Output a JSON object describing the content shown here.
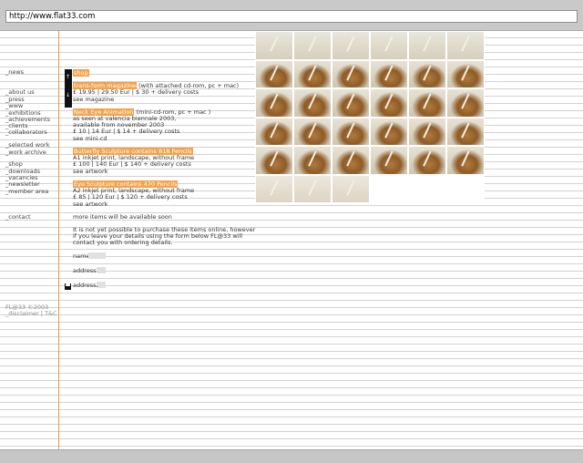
{
  "browser": {
    "url": "http://www.flat33.com"
  },
  "nav": {
    "news": "_news",
    "about_us": "_about us",
    "press": "_press",
    "www": "_www",
    "exhibitions": "_exhibitions",
    "achievements": "_achievements",
    "clients": "_clients",
    "collaborators": "_collaborators",
    "selected_work": "_selected work",
    "work_archive": "_work archive",
    "shop": "_shop",
    "downloads": "_downloads",
    "vacancies": "_vacancies",
    "newsletter": "_newsletter",
    "member_area": "_member area",
    "contact": "_contact",
    "copyright": "FL@33 ©2003",
    "disclaimer": "_disclaimer | T&C"
  },
  "sidebar": {
    "up_arrow": "↑",
    "down_arrow": "↓"
  },
  "shop": {
    "heading": "shop",
    "items": [
      {
        "title": "trans-form magazine",
        "desc": " (with attached cd-rom, pc + mac)",
        "price": "£ 19.95 | 29.50 Eur | $ 30 + delivery costs",
        "link": "see magazine"
      },
      {
        "title": "Neck Eye Animation",
        "desc": " (mini-cd-rom, pc + mac )",
        "note1": "as seen at valencia biennale 2003,",
        "note2": "available from november 2003",
        "price": "£ 10 | 14 Eur | $ 14 + delivery costs",
        "link": "see mini-cd"
      },
      {
        "title": "Butterfly Sculpture contains 818 Pencils",
        "desc": "",
        "note1": "A1 inkjet print, landscape, without frame",
        "price": "£ 100 | 140 Eur | $ 140 + delivery costs",
        "link": "see artwork"
      },
      {
        "title": "Eye Sculpture contains 470 Pencils",
        "desc": "",
        "note1": "A2 inkjet print, landscape, without frame",
        "price": "£ 85 | 120 Eur | $ 120 + delivery costs",
        "link": "see artwork"
      }
    ],
    "more_items": "more items will be available soon",
    "info1": "It is not yet possible to purchase these items online, however",
    "info2": "if you leave your details using the form below FL@33 will",
    "info3": "contact you with ordering details."
  },
  "form": {
    "name_label": "name",
    "address1_label": "address1",
    "address2_label": "address2"
  },
  "colors": {
    "accent": "#f3a24a",
    "rule": "#f09a3e"
  }
}
